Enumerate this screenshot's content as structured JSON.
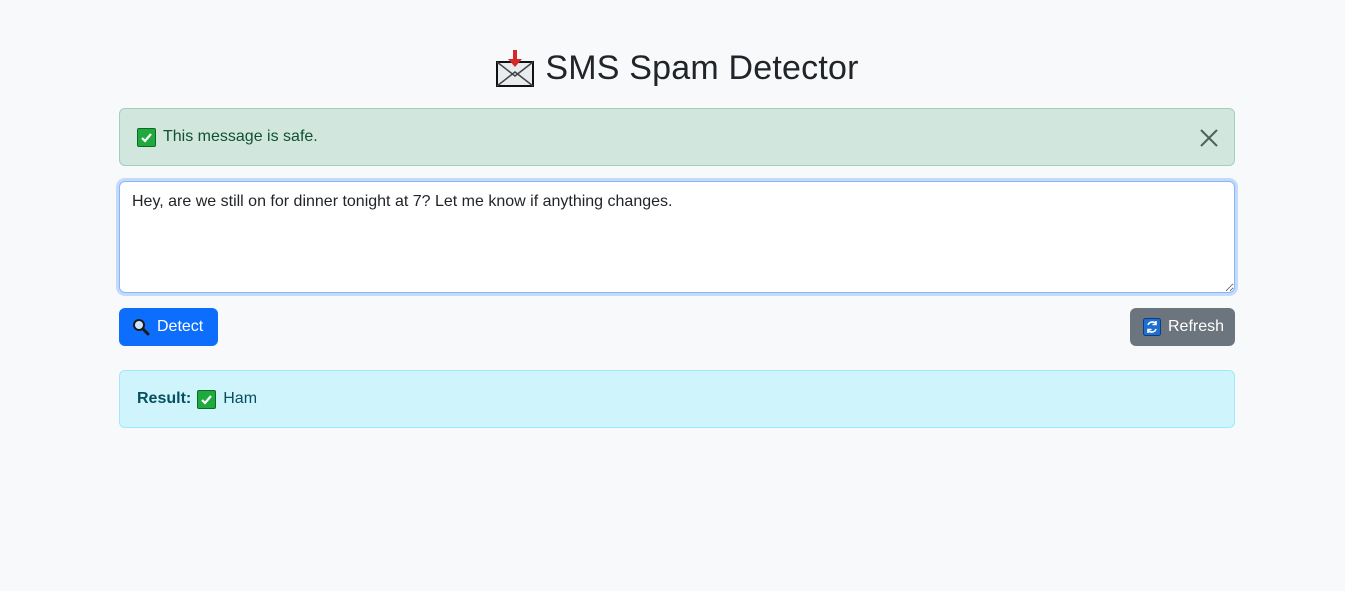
{
  "header": {
    "title": "SMS Spam Detector",
    "icon": "inbox-tray-icon"
  },
  "status_alert": {
    "text": "This message is safe.",
    "icon": "check-mark-button-icon",
    "close_icon": "close-icon"
  },
  "message_input": {
    "value": "Hey, are we still on for dinner tonight at 7? Let me know if anything changes."
  },
  "actions": {
    "detect_label": "Detect",
    "detect_icon": "magnifier-icon",
    "refresh_label": "Refresh",
    "refresh_icon": "refresh-arrows-icon"
  },
  "result": {
    "label": "Result:",
    "value": "Ham",
    "icon": "check-mark-button-icon"
  },
  "colors": {
    "primary": "#0d6efd",
    "secondary": "#6c757d",
    "success_bg": "#d1e7dd",
    "info_bg": "#cff4fc"
  }
}
